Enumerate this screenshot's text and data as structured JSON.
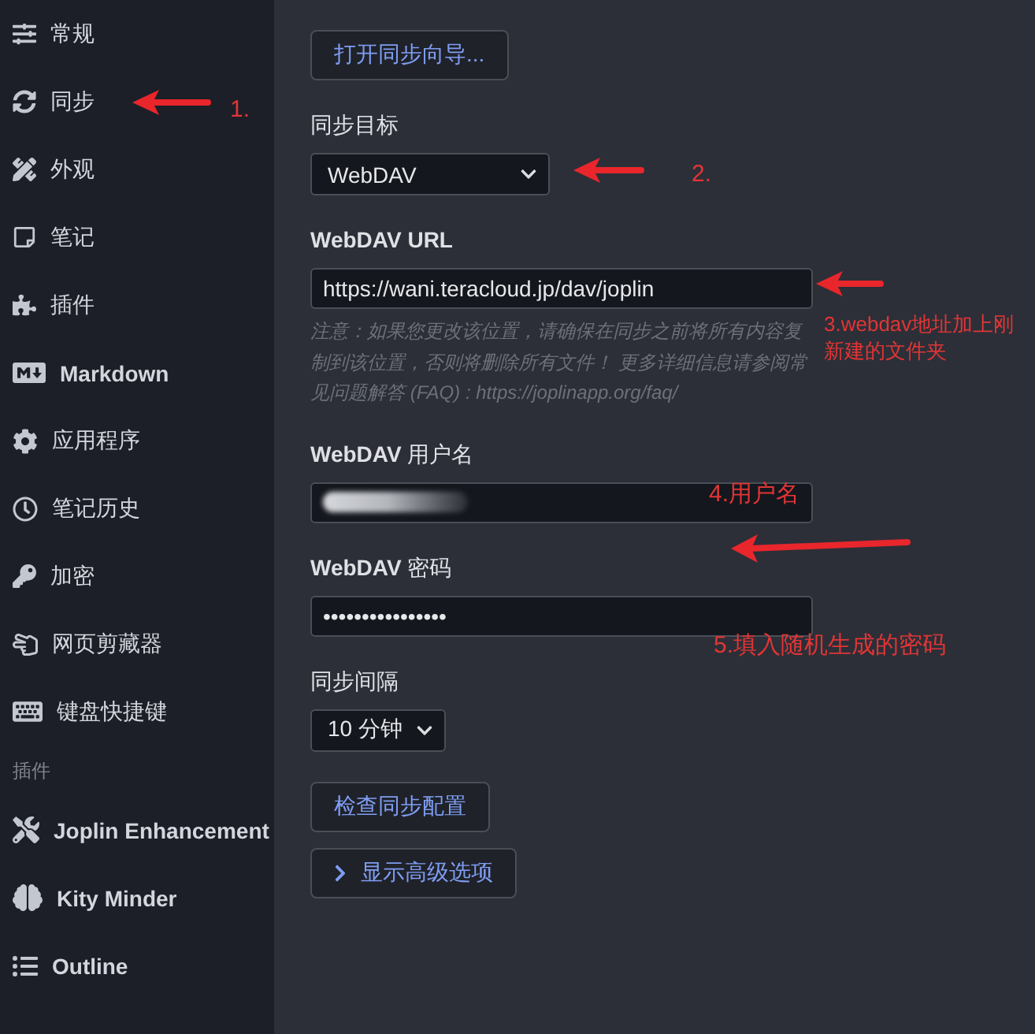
{
  "sidebar": {
    "items": [
      "常规",
      "同步",
      "外观",
      "笔记",
      "插件",
      "Markdown",
      "应用程序",
      "笔记历史",
      "加密",
      "网页剪藏器",
      "键盘快捷键"
    ],
    "section_label": "插件",
    "plugin_items": [
      "Joplin Enhancement",
      "Kity Minder",
      "Outline"
    ]
  },
  "sync_wizard_button": "打开同步向导...",
  "fields": [
    {
      "kind": "select",
      "label": "同步目标",
      "value": "WebDAV"
    },
    {
      "kind": "text",
      "label": "WebDAV URL",
      "value": "https://wani.teracloud.jp/dav/joplin",
      "hint": "注意：如果您更改该位置，请确保在同步之前将所有内容复制到该位置，否则将删除所有文件！ 更多详细信息请参阅常见问题解答 (FAQ) : https://joplinapp.org/faq/"
    },
    {
      "kind": "text",
      "label": "WebDAV 用户名",
      "redacted": true
    },
    {
      "kind": "password",
      "label": "WebDAV 密码",
      "value": "••••••••••••••••"
    },
    {
      "kind": "select",
      "label": "同步间隔",
      "value": "10 分钟"
    }
  ],
  "check_button": "检查同步配置",
  "advanced_button": {
    "label": "显示高级选项",
    "expanded": false
  },
  "annotations": [
    "1.",
    "2.",
    "3.webdav地址加上刚新建的文件夹",
    "4.用户名",
    "5.填入随机生成的密码"
  ]
}
